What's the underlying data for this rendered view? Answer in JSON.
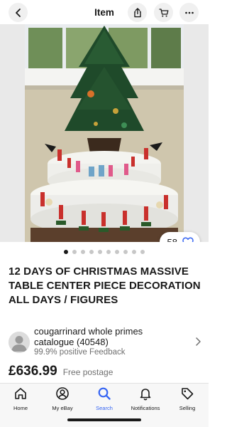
{
  "header": {
    "title": "Item",
    "back_icon": "chevron-left-icon",
    "share_icon": "share-icon",
    "cart_icon": "cart-icon",
    "more_icon": "more-horizontal-icon"
  },
  "gallery": {
    "image_alt": "Christmas tree table centerpiece with figures",
    "watch_count": "58",
    "watch_icon": "heart-icon",
    "image_count": 10,
    "active_index": 0
  },
  "listing": {
    "title": "12 DAYS OF CHRISTMAS MASSIVE TABLE CENTER PIECE DECORATION ALL DAYS / FIGURES"
  },
  "seller": {
    "name": "cougarrinard whole primes catalogue (40548)",
    "feedback": "99.9% positive Feedback"
  },
  "price": {
    "amount": "£636.99",
    "postage": "Free postage"
  },
  "nav": {
    "items": [
      {
        "label": "Home",
        "icon": "home-icon"
      },
      {
        "label": "My eBay",
        "icon": "profile-icon"
      },
      {
        "label": "Search",
        "icon": "search-icon"
      },
      {
        "label": "Notifications",
        "icon": "bell-icon"
      },
      {
        "label": "Selling",
        "icon": "tag-icon"
      }
    ],
    "active": "Search"
  },
  "colors": {
    "accent": "#3665f3",
    "text": "#191919",
    "muted": "#707070"
  }
}
